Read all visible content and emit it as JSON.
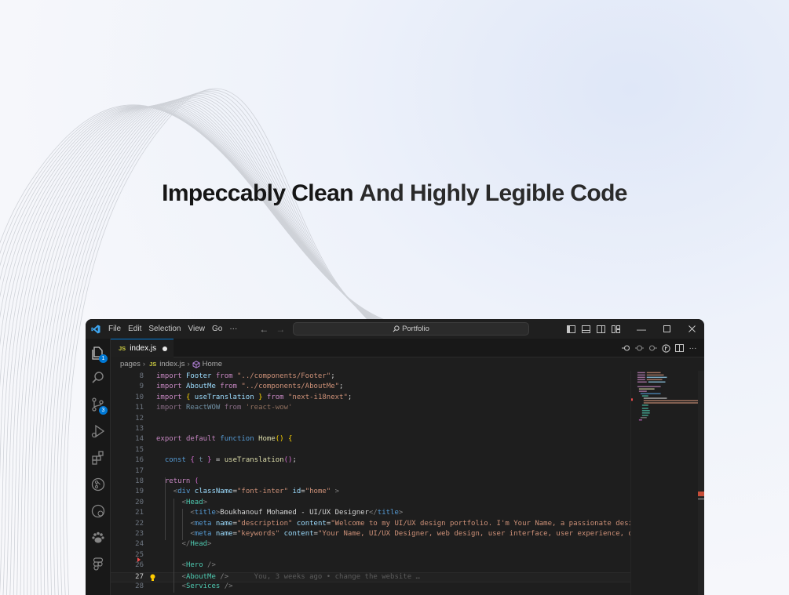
{
  "headline": {
    "bold_part": "Impeccably Clean",
    "rest": "And Highly Legible Code"
  },
  "titlebar": {
    "menu": [
      "File",
      "Edit",
      "Selection",
      "View",
      "Go",
      "···"
    ],
    "search_text": "Portfolio"
  },
  "activity_badges": {
    "explorer": "1",
    "source_control": "3"
  },
  "tab": {
    "file_icon": "JS",
    "label": "index.js"
  },
  "breadcrumb": {
    "folder": "pages",
    "file_icon": "JS",
    "file": "index.js",
    "symbol": "Home"
  },
  "editor": {
    "active_line": 27,
    "lines": [
      {
        "n": 8,
        "tokens": [
          [
            "kw",
            "import"
          ],
          [
            "p",
            " "
          ],
          [
            "var",
            "Footer"
          ],
          [
            "p",
            " "
          ],
          [
            "kw",
            "from"
          ],
          [
            "p",
            " "
          ],
          [
            "str",
            "\"../components/Footer\""
          ],
          [
            "p",
            ";"
          ]
        ]
      },
      {
        "n": 9,
        "tokens": [
          [
            "kw",
            "import"
          ],
          [
            "p",
            " "
          ],
          [
            "var",
            "AboutMe"
          ],
          [
            "p",
            " "
          ],
          [
            "kw",
            "from"
          ],
          [
            "p",
            " "
          ],
          [
            "str",
            "\"../components/AboutMe\""
          ],
          [
            "p",
            ";"
          ]
        ]
      },
      {
        "n": 10,
        "tokens": [
          [
            "kw",
            "import"
          ],
          [
            "p",
            " "
          ],
          [
            "brace",
            "{"
          ],
          [
            "p",
            " "
          ],
          [
            "var",
            "useTranslation"
          ],
          [
            "p",
            " "
          ],
          [
            "brace",
            "}"
          ],
          [
            "p",
            " "
          ],
          [
            "kw",
            "from"
          ],
          [
            "p",
            " "
          ],
          [
            "str",
            "\"next-i18next\""
          ],
          [
            "p",
            ";"
          ]
        ]
      },
      {
        "n": 11,
        "tokens": [
          [
            "dimkw",
            "import"
          ],
          [
            "p",
            " "
          ],
          [
            "dimvar",
            "ReactWOW"
          ],
          [
            "p",
            " "
          ],
          [
            "dimkw",
            "from"
          ],
          [
            "p",
            " "
          ],
          [
            "dimstr",
            "'react-wow'"
          ]
        ]
      },
      {
        "n": 12,
        "tokens": []
      },
      {
        "n": 13,
        "tokens": []
      },
      {
        "n": 14,
        "tokens": [
          [
            "kw",
            "export"
          ],
          [
            "p",
            " "
          ],
          [
            "kw",
            "default"
          ],
          [
            "p",
            " "
          ],
          [
            "blue",
            "function"
          ],
          [
            "p",
            " "
          ],
          [
            "fn",
            "Home"
          ],
          [
            "brace",
            "()"
          ],
          [
            "p",
            " "
          ],
          [
            "brace",
            "{"
          ]
        ]
      },
      {
        "n": 15,
        "tokens": []
      },
      {
        "n": 16,
        "tokens": [
          [
            "p",
            "  "
          ],
          [
            "blue",
            "const"
          ],
          [
            "p",
            " "
          ],
          [
            "brace2",
            "{"
          ],
          [
            "p",
            " "
          ],
          [
            "dimvar",
            "t"
          ],
          [
            "p",
            " "
          ],
          [
            "brace2",
            "}"
          ],
          [
            "p",
            " = "
          ],
          [
            "fn",
            "useTranslation"
          ],
          [
            "brace2",
            "()"
          ],
          [
            "p",
            ";"
          ]
        ]
      },
      {
        "n": 17,
        "tokens": []
      },
      {
        "n": 18,
        "tokens": [
          [
            "p",
            "  "
          ],
          [
            "kw",
            "return"
          ],
          [
            "p",
            " "
          ],
          [
            "brace2",
            "("
          ]
        ]
      },
      {
        "n": 19,
        "tokens": [
          [
            "p",
            "    "
          ],
          [
            "tagb",
            "<"
          ],
          [
            "tag",
            "div"
          ],
          [
            "p",
            " "
          ],
          [
            "attr",
            "className"
          ],
          [
            "p",
            "="
          ],
          [
            "str",
            "\"font-inter\""
          ],
          [
            "p",
            " "
          ],
          [
            "attr",
            "id"
          ],
          [
            "p",
            "="
          ],
          [
            "str",
            "\"home\""
          ],
          [
            "p",
            " "
          ],
          [
            "tagb",
            ">"
          ]
        ]
      },
      {
        "n": 20,
        "tokens": [
          [
            "p",
            "      "
          ],
          [
            "tagb",
            "<"
          ],
          [
            "comp",
            "Head"
          ],
          [
            "tagb",
            ">"
          ]
        ]
      },
      {
        "n": 21,
        "tokens": [
          [
            "p",
            "        "
          ],
          [
            "tagb",
            "<"
          ],
          [
            "tag",
            "title"
          ],
          [
            "tagb",
            ">"
          ],
          [
            "p",
            "Boukhanouf Mohamed - UI/UX Designer"
          ],
          [
            "tagb",
            "</"
          ],
          [
            "tag",
            "title"
          ],
          [
            "tagb",
            ">"
          ]
        ]
      },
      {
        "n": 22,
        "tokens": [
          [
            "p",
            "        "
          ],
          [
            "tagb",
            "<"
          ],
          [
            "tag",
            "meta"
          ],
          [
            "p",
            " "
          ],
          [
            "attr",
            "name"
          ],
          [
            "p",
            "="
          ],
          [
            "str",
            "\"description\""
          ],
          [
            "p",
            " "
          ],
          [
            "attr",
            "content"
          ],
          [
            "p",
            "="
          ],
          [
            "str",
            "\"Welcome to my UI/UX design portfolio. I'm Your Name, a passionate desig"
          ]
        ]
      },
      {
        "n": 23,
        "tokens": [
          [
            "p",
            "        "
          ],
          [
            "tagb",
            "<"
          ],
          [
            "tag",
            "meta"
          ],
          [
            "p",
            " "
          ],
          [
            "attr",
            "name"
          ],
          [
            "p",
            "="
          ],
          [
            "str",
            "\"keywords\""
          ],
          [
            "p",
            " "
          ],
          [
            "attr",
            "content"
          ],
          [
            "p",
            "="
          ],
          [
            "str",
            "\"Your Name, UI/UX Designer, web design, user interface, user experience, de"
          ]
        ]
      },
      {
        "n": 24,
        "tokens": [
          [
            "p",
            "      "
          ],
          [
            "tagb",
            "</"
          ],
          [
            "comp",
            "Head"
          ],
          [
            "tagb",
            ">"
          ]
        ]
      },
      {
        "n": 25,
        "tokens": []
      },
      {
        "n": 26,
        "tokens": [
          [
            "p",
            "      "
          ],
          [
            "tagb",
            "<"
          ],
          [
            "comp",
            "Hero"
          ],
          [
            "p",
            " "
          ],
          [
            "tagb",
            "/>"
          ]
        ]
      },
      {
        "n": 27,
        "tokens": [
          [
            "p",
            "      "
          ],
          [
            "tagb",
            "<"
          ],
          [
            "comp",
            "AboutMe"
          ],
          [
            "p",
            " "
          ],
          [
            "tagb",
            "/>"
          ],
          [
            "p",
            "      "
          ],
          [
            "blame",
            "You, 3 weeks ago • change the website …"
          ]
        ]
      },
      {
        "n": 28,
        "tokens": [
          [
            "p",
            "      "
          ],
          [
            "tagb",
            "<"
          ],
          [
            "comp",
            "Services"
          ],
          [
            "p",
            " "
          ],
          [
            "tagb",
            "/>"
          ]
        ]
      }
    ]
  },
  "colors": {
    "kw": "#c586c0",
    "var": "#9cdcfe",
    "str": "#ce9178",
    "p": "#d4d4d4",
    "brace": "#ffd700",
    "brace2": "#da70d6",
    "blue": "#569cd6",
    "fn": "#dcdcaa",
    "tag": "#569cd6",
    "tagb": "#808080",
    "attr": "#9cdcfe",
    "comp": "#4ec9b0",
    "dimkw": "#8a6d87",
    "dimvar": "#6f8fa3",
    "dimstr": "#8f6f5e",
    "blame": "#5c5c5c",
    "accent": "#0078d4"
  }
}
